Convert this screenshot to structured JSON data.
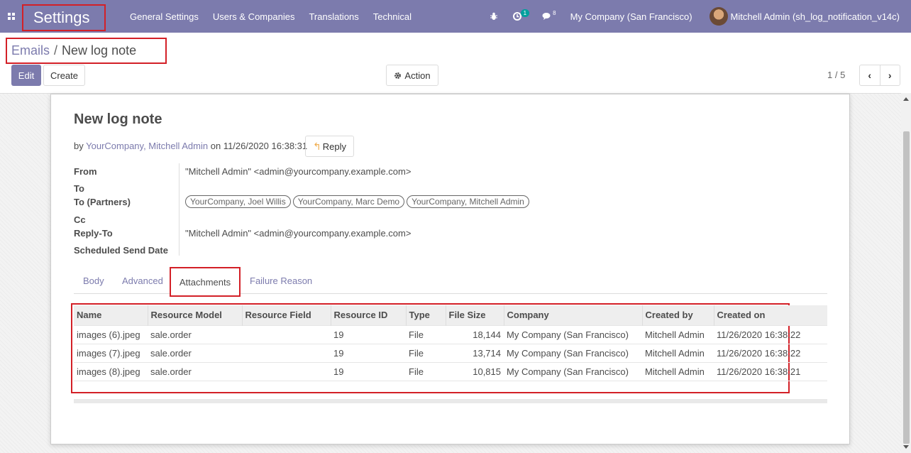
{
  "navbar": {
    "app_title": "Settings",
    "menu": [
      "General Settings",
      "Users & Companies",
      "Translations",
      "Technical"
    ],
    "activity_badge": "1",
    "messages_count": "8",
    "company": "My Company (San Francisco)",
    "user": "Mitchell Admin (sh_log_notification_v14c)"
  },
  "breadcrumb": {
    "parent": "Emails",
    "separator": "/",
    "current": "New log note"
  },
  "buttons": {
    "edit": "Edit",
    "create": "Create",
    "action": "Action"
  },
  "pager": {
    "value": "1 / 5"
  },
  "mail": {
    "subject": "New log note",
    "by_prefix": "by",
    "author": "YourCompany, Mitchell Admin",
    "on_text": "on 11/26/2020 16:38:31",
    "reply_label": "Reply"
  },
  "fields": {
    "from_label": "From",
    "from_value": "\"Mitchell Admin\" <admin@yourcompany.example.com>",
    "to_label": "To",
    "to_partners_label": "To (Partners)",
    "partners": [
      "YourCompany, Joel Willis",
      "YourCompany, Marc Demo",
      "YourCompany, Mitchell Admin"
    ],
    "cc_label": "Cc",
    "reply_to_label": "Reply-To",
    "reply_to_value": "\"Mitchell Admin\" <admin@yourcompany.example.com>",
    "scheduled_label": "Scheduled Send Date"
  },
  "tabs": [
    "Body",
    "Advanced",
    "Attachments",
    "Failure Reason"
  ],
  "attachments": {
    "columns": [
      "Name",
      "Resource Model",
      "Resource Field",
      "Resource ID",
      "Type",
      "File Size",
      "Company",
      "Created by",
      "Created on"
    ],
    "rows": [
      [
        "images (6).jpeg",
        "sale.order",
        "",
        "19",
        "File",
        "18,144",
        "My Company (San Francisco)",
        "Mitchell Admin",
        "11/26/2020 16:38:22"
      ],
      [
        "images (7).jpeg",
        "sale.order",
        "",
        "19",
        "File",
        "13,714",
        "My Company (San Francisco)",
        "Mitchell Admin",
        "11/26/2020 16:38:22"
      ],
      [
        "images (8).jpeg",
        "sale.order",
        "",
        "19",
        "File",
        "10,815",
        "My Company (San Francisco)",
        "Mitchell Admin",
        "11/26/2020 16:38:21"
      ]
    ]
  },
  "colors": {
    "brand": "#7c7bad",
    "highlight": "#d32027",
    "badge": "#00a09d"
  }
}
